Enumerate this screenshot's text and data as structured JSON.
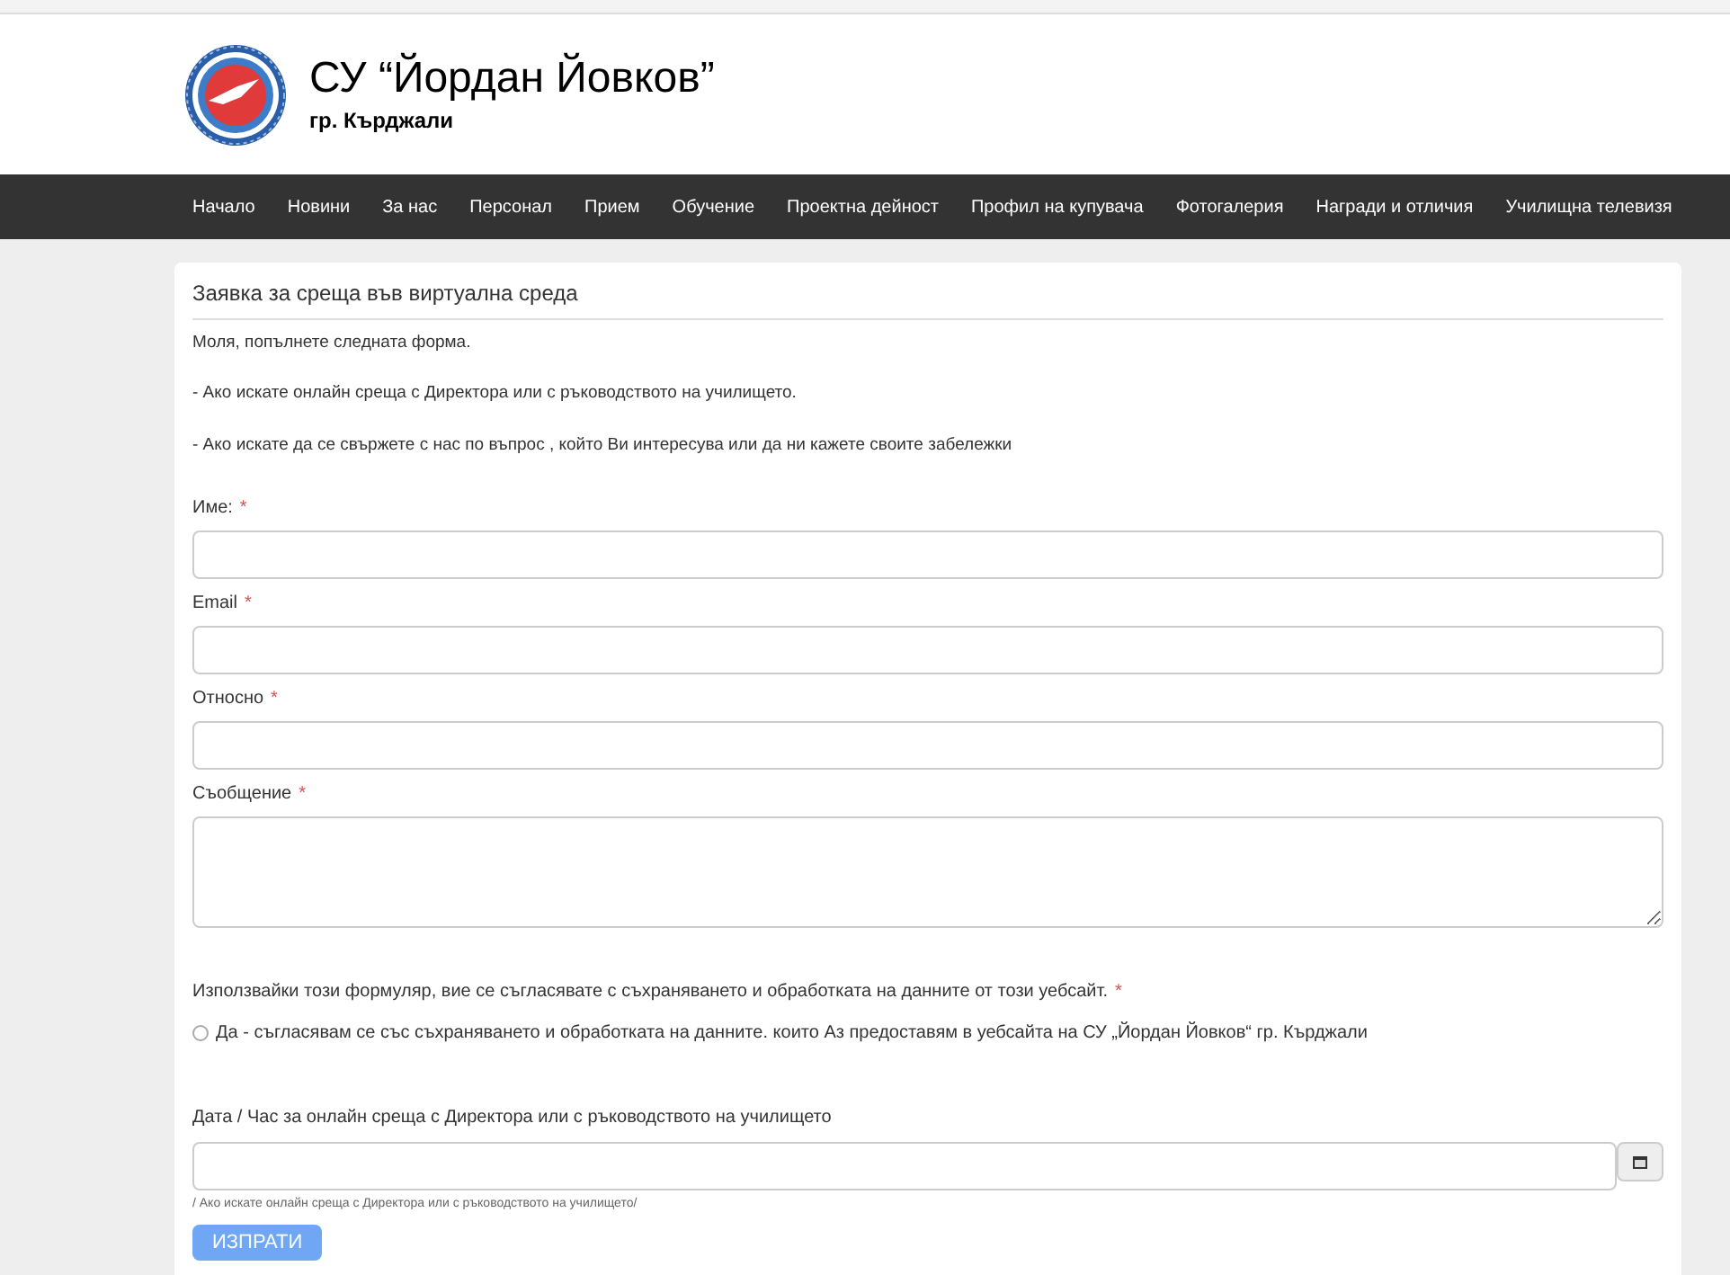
{
  "header": {
    "title": "СУ “Йордан Йовков”",
    "subtitle": "гр. Кърджали"
  },
  "nav": [
    {
      "label": "Начало"
    },
    {
      "label": "Новини"
    },
    {
      "label": "За нас"
    },
    {
      "label": "Персонал"
    },
    {
      "label": "Прием"
    },
    {
      "label": "Обучение"
    },
    {
      "label": "Проектна дейност"
    },
    {
      "label": "Профил на купувача"
    },
    {
      "label": "Фотогалерия"
    },
    {
      "label": "Награди и отличия"
    },
    {
      "label": "Училищна телевизя"
    }
  ],
  "form": {
    "title": "Заявка за среща във виртуална среда",
    "intro": [
      "Моля, попълнете следната форма.",
      "-  Ако искате онлайн среща с Директора или с ръководството на училището.",
      "- Ако искате да се свържете с нас по въпрос , който Ви интересува или да ни кажете своите забележки"
    ],
    "fields": [
      {
        "label": "Име:",
        "required_mark": "*",
        "kind": "input"
      },
      {
        "label": "Email",
        "required_mark": "*",
        "kind": "input"
      },
      {
        "label": "Относно",
        "required_mark": "*",
        "kind": "input"
      },
      {
        "label": "Съобщение",
        "required_mark": "*",
        "kind": "textarea"
      }
    ],
    "consent": {
      "label": "Използвайки този формуляр, вие се съгласявате с съхраняването и обработката на данните от този уебсайт.",
      "required_mark": "*",
      "option": {
        "label": "Да - съгласявам се със съхраняването и обработката на данните. които Аз предоставям в уебсайта на СУ „Йордан Йовков“ гр. Кърджали",
        "selected": false
      }
    },
    "date": {
      "label": "Дата / Час за онлайн среща с Директора или с ръководството на училището",
      "hint": "/ Ако искате онлайн среща с Директора или с ръководството на училището/"
    },
    "submit": "ИЗПРАТИ"
  }
}
